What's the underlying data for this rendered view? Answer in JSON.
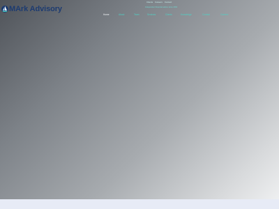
{
  "brand": {
    "name": "MArk Advisory",
    "logo_icon": "sailboat-icon",
    "colors": {
      "brand_navy": "#1d3b70",
      "accent_teal": "#4fd2c6"
    }
  },
  "util_nav": [
    "Clients",
    "Careers",
    "Contact"
  ],
  "tagline": "Independent financial advice since 2004",
  "main_nav": {
    "active": "Home",
    "items": [
      "Home",
      "About",
      "Team",
      "Services",
      "Clients",
      "Knowledge",
      "Contact",
      "Careers"
    ]
  }
}
